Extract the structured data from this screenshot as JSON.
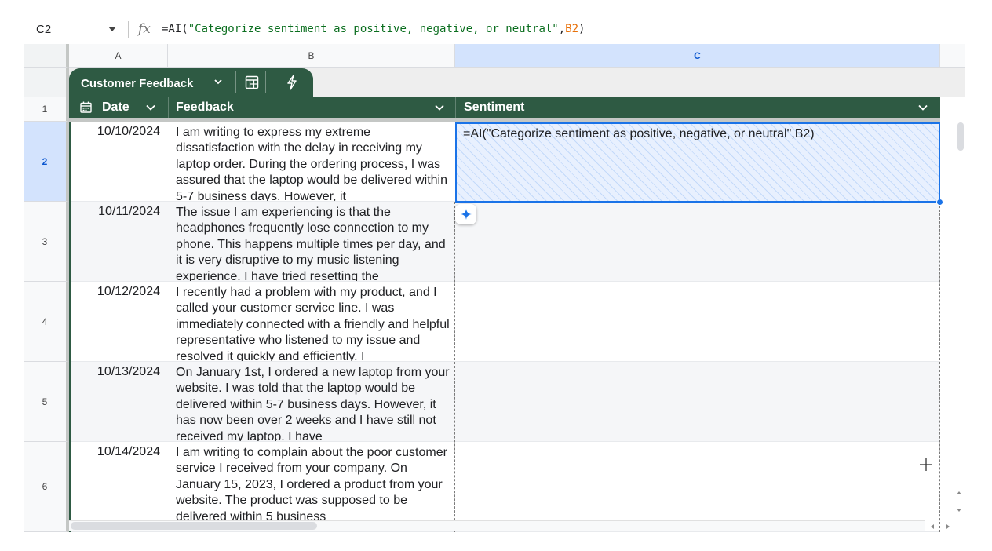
{
  "formula_bar": {
    "cell_ref": "C2",
    "fx": "fx",
    "formula_prefix": "=AI(",
    "formula_string": "\"Categorize sentiment as positive, negative, or neutral\"",
    "formula_comma": ",",
    "formula_ref": "B2",
    "formula_suffix": ")"
  },
  "columns": [
    "A",
    "B",
    "C"
  ],
  "table": {
    "name": "Customer Feedback",
    "headers": {
      "date": "Date",
      "feedback": "Feedback",
      "sentiment": "Sentiment"
    },
    "header_row_number": "1",
    "accent_color": "#2e5a43"
  },
  "rows": [
    {
      "num": "2",
      "date": "10/10/2024",
      "feedback": "I am writing to express my extreme dissatisfaction with the delay in receiving my laptop order. During the ordering process, I was assured that the laptop would be delivered within 5-7 business days. However, it",
      "sentiment": "=AI(\"Categorize sentiment as positive, negative, or neutral\",B2)"
    },
    {
      "num": "3",
      "date": "10/11/2024",
      "feedback": "The issue I am experiencing is that the headphones frequently lose connection to my phone. This happens multiple times per day, and it is very disruptive to my music listening experience. I have tried resetting the",
      "sentiment": ""
    },
    {
      "num": "4",
      "date": "10/12/2024",
      "feedback": "I recently had a problem with my product, and I called your customer service line. I was immediately connected with a friendly and helpful representative who listened to my issue and resolved it quickly and efficiently. I",
      "sentiment": ""
    },
    {
      "num": "5",
      "date": "10/13/2024",
      "feedback": "On January 1st, I ordered a new laptop from your website. I was told that the laptop would be delivered within 5-7 business days. However, it has now been over 2 weeks and I have still not received my laptop. I have",
      "sentiment": ""
    },
    {
      "num": "6",
      "date": "10/14/2024",
      "feedback": "I am writing to complain about the poor customer service I received from your company. On January 15, 2023, I ordered a product from your website. The product was supposed to be delivered within 5 business",
      "sentiment": ""
    }
  ],
  "icons": {
    "namebox_dropdown": "chevron-down-icon",
    "table_menu": "chevron-down-icon",
    "calculator": "calculator-icon",
    "automation": "lightning-icon",
    "date_column": "calendar-icon",
    "ai_assist": "sparkle-icon",
    "cursor": "plus-icon"
  }
}
